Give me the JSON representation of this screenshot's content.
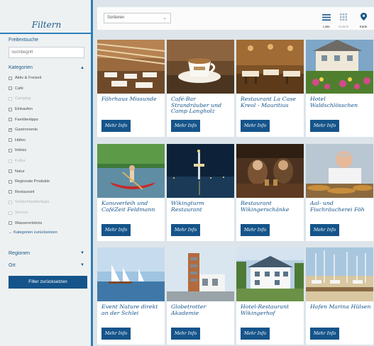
{
  "sidebar": {
    "title": "Filtern",
    "freetext_label": "Freitextsuche",
    "search_placeholder": "Suchbegriff",
    "categories_label": "Kategorien",
    "categories": [
      {
        "label": "Aktiv & Freizeit",
        "checked": false,
        "dim": false
      },
      {
        "label": "Café",
        "checked": false,
        "dim": false
      },
      {
        "label": "Camping",
        "checked": false,
        "dim": true
      },
      {
        "label": "Einkaufen",
        "checked": false,
        "dim": false
      },
      {
        "label": "Familientipps",
        "checked": false,
        "dim": false
      },
      {
        "label": "Gastronomie",
        "checked": true,
        "dim": false
      },
      {
        "label": "Häfen",
        "checked": false,
        "dim": false
      },
      {
        "label": "Imbiss",
        "checked": false,
        "dim": false
      },
      {
        "label": "Kultur",
        "checked": false,
        "dim": true
      },
      {
        "label": "Natur",
        "checked": false,
        "dim": false
      },
      {
        "label": "Regionale Produkte",
        "checked": false,
        "dim": false
      },
      {
        "label": "Restaurant",
        "checked": false,
        "dim": false
      },
      {
        "label": "Schlechtwettertipps",
        "checked": false,
        "dim": true
      },
      {
        "label": "Service",
        "checked": false,
        "dim": true
      },
      {
        "label": "Wassererlebnis",
        "checked": false,
        "dim": false
      }
    ],
    "reset_categories": "Kategorien zurücksetzen",
    "regions_label": "Regionen",
    "place_label": "Ort",
    "reset_button": "Filter zurücksetzen"
  },
  "toolbar": {
    "sort_label": "Sortieren",
    "views": [
      {
        "label": "Liste",
        "icon": "list-icon"
      },
      {
        "label": "Galerie",
        "icon": "grid-icon"
      },
      {
        "label": "Karte",
        "icon": "map-pin-icon"
      }
    ]
  },
  "colors": {
    "accent": "#15548a",
    "sidebar_border": "#2d7fb8"
  },
  "cards": [
    {
      "title": "Fährhaus Missunde",
      "button": "Mehr Info",
      "image": "wooden-restaurant-hall"
    },
    {
      "title": "Café-Bar Strandräuber und Camp Langholz",
      "button": "Mehr Info",
      "image": "coffee-cup"
    },
    {
      "title": "Restaurant La Case Kreol - Mauritius",
      "button": "Mehr Info",
      "image": "restaurant-interior"
    },
    {
      "title": "Hotel Waldschlösschen",
      "button": "Mehr Info",
      "image": "hotel-garden"
    },
    {
      "title": "Kanuverleih und CaféZeit Feldmann",
      "button": "Mehr Info",
      "image": "red-canoe"
    },
    {
      "title": "Wikingturm Restaurant",
      "button": "Mehr Info",
      "image": "tower-at-night"
    },
    {
      "title": "Restaurant Wikingerschänke",
      "button": "Mehr Info",
      "image": "viking-tavern"
    },
    {
      "title": "Aal- und Fischräucherei Föh",
      "button": "Mehr Info",
      "image": "fishmonger"
    },
    {
      "title": "Event Nature direkt an der Schlei",
      "button": "Mehr Info",
      "image": "sailboats"
    },
    {
      "title": "Globetrotter Akademie",
      "button": "Mehr Info",
      "image": "tower-building"
    },
    {
      "title": "Hotel-Restaurant Wikingerhof",
      "button": "Mehr Info",
      "image": "white-hotel"
    },
    {
      "title": "Hafen Marina Hülsen",
      "button": "Mehr Info",
      "image": "marina"
    }
  ]
}
